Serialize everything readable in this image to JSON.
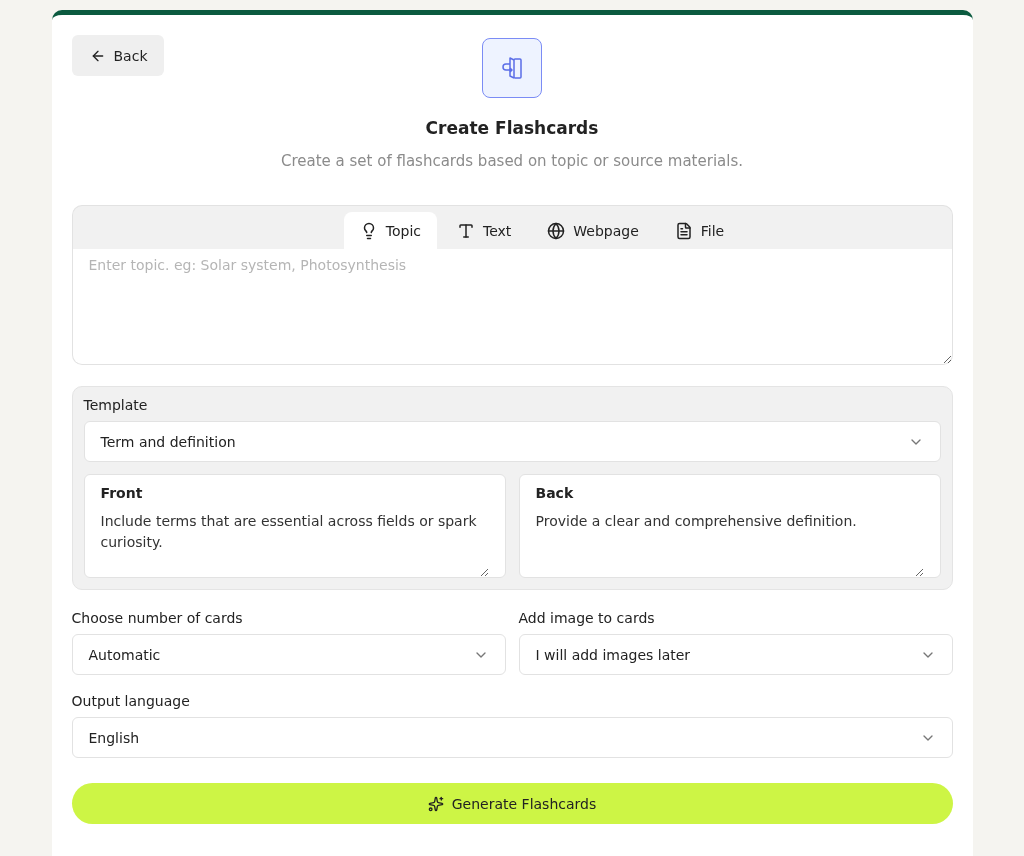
{
  "back_button": {
    "label": "Back"
  },
  "header": {
    "title": "Create Flashcards",
    "subtitle": "Create a set of flashcards based on topic or source materials."
  },
  "source_tabs": [
    {
      "kind": "topic",
      "label": "Topic",
      "selected": true
    },
    {
      "kind": "text",
      "label": "Text",
      "selected": false
    },
    {
      "kind": "webpage",
      "label": "Webpage",
      "selected": false
    },
    {
      "kind": "file",
      "label": "File",
      "selected": false
    }
  ],
  "source_input": {
    "placeholder": "Enter topic. eg: Solar system, Photosynthesis"
  },
  "template": {
    "label": "Template",
    "value": "Term and definition",
    "sides": [
      {
        "label": "Front",
        "value": "Include terms that are essential across fields or spark curiosity."
      },
      {
        "label": "Back",
        "value": "Provide a clear and comprehensive definition."
      }
    ]
  },
  "options": [
    {
      "label": "Choose number of cards",
      "value": "Automatic"
    },
    {
      "label": "Add image to cards",
      "value": "I will add images later"
    }
  ],
  "output_language": {
    "label": "Output language",
    "value": "English"
  },
  "generate_button": {
    "label": "Generate Flashcards"
  }
}
